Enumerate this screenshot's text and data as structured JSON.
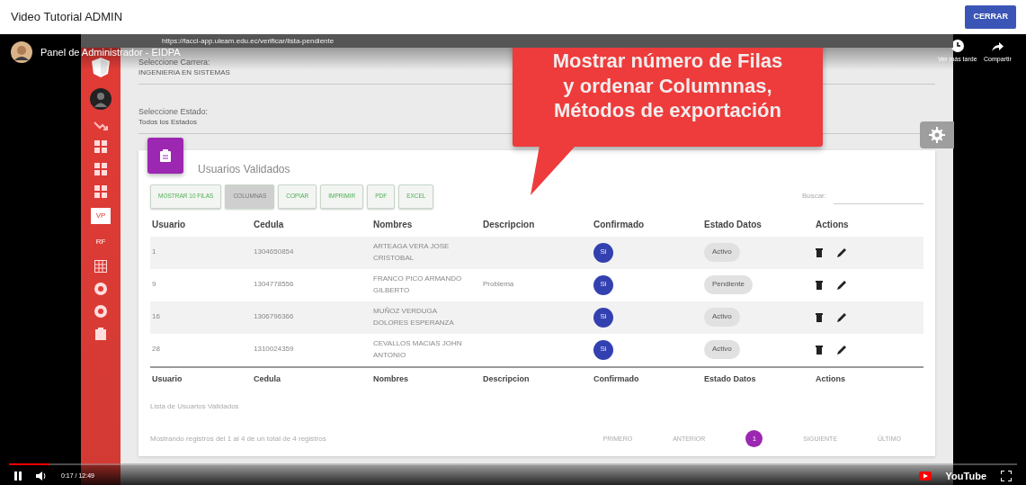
{
  "header": {
    "title": "Video Tutorial ADMIN",
    "close_button": "CERRAR"
  },
  "player": {
    "title": "Panel de Administrador - EIDPA",
    "actions": [
      "Ver más tarde",
      "Compartir"
    ],
    "time": "0:17 / 12:49",
    "progress": {
      "level": 0.04
    },
    "brand": "YouTube"
  },
  "browser": {
    "url": "https://facci-app.uleam.edu.ec/verificar/lista-pendiente"
  },
  "sidebar": {
    "items": [
      {
        "label": "VP",
        "selected": true
      },
      {
        "label": "RF",
        "selected": false
      }
    ]
  },
  "filters": [
    {
      "label": "Seleccione Carrera:",
      "value": "INGENIERIA EN SISTEMAS"
    },
    {
      "label": "Seleccione Estado:",
      "value": "Todos los Estados"
    }
  ],
  "callout": {
    "lines": [
      "Mostrar número de Filas",
      "y ordenar Columnnas,",
      "Métodos de exportación"
    ]
  },
  "card": {
    "title": "Usuarios Validados",
    "buttons": [
      {
        "label": "MOSTRAR 10 FILAS",
        "selected": false
      },
      {
        "label": "COLUMNAS",
        "selected": true
      },
      {
        "label": "COPIAR",
        "selected": false
      },
      {
        "label": "IMPRIMIR",
        "selected": false
      },
      {
        "label": "PDF",
        "selected": false
      },
      {
        "label": "EXCEL",
        "selected": false
      }
    ],
    "search_label": "Buscar:",
    "columns": [
      "Usuario",
      "Cedula",
      "Nombres",
      "Descripcion",
      "Confirmado",
      "Estado Datos",
      "Actions"
    ],
    "rows": [
      {
        "usuario": "1",
        "cedula": "1304650854",
        "nombres": "ARTEAGA VERA JOSE CRISTOBAL",
        "confirmado": "Si",
        "estado": "Activo"
      },
      {
        "usuario": "9",
        "cedula": "1304778556",
        "nombres": "FRANCO PICO ARMANDO GILBERTO",
        "descripcion": "Problema",
        "confirmado": "Si",
        "estado": "Pendiente"
      },
      {
        "usuario": "16",
        "cedula": "1306796366",
        "nombres": "MUÑOZ VERDUGA DOLORES ESPERANZA",
        "confirmado": "Si",
        "estado": "Activo"
      },
      {
        "usuario": "28",
        "cedula": "1310024359",
        "nombres": "CEVALLOS MACIAS JOHN ANTONIO",
        "confirmado": "Si",
        "estado": "Activo"
      }
    ],
    "footer_columns": [
      "Usuario",
      "Cedula",
      "Nombres",
      "Descripcion",
      "Confirmado",
      "Estado Datos",
      "Actions"
    ],
    "caption": "Lista de Usuarios Validados",
    "info": "Mostrando registros del 1 al 4 de un total de 4 registros",
    "pagination": [
      {
        "label": "PRIMERO",
        "selected": false
      },
      {
        "label": "ANTERIOR",
        "selected": false
      },
      {
        "label": "1",
        "selected": true
      },
      {
        "label": "SIGUIENTE",
        "selected": false
      },
      {
        "label": "ÚLTIMO",
        "selected": false
      }
    ]
  }
}
